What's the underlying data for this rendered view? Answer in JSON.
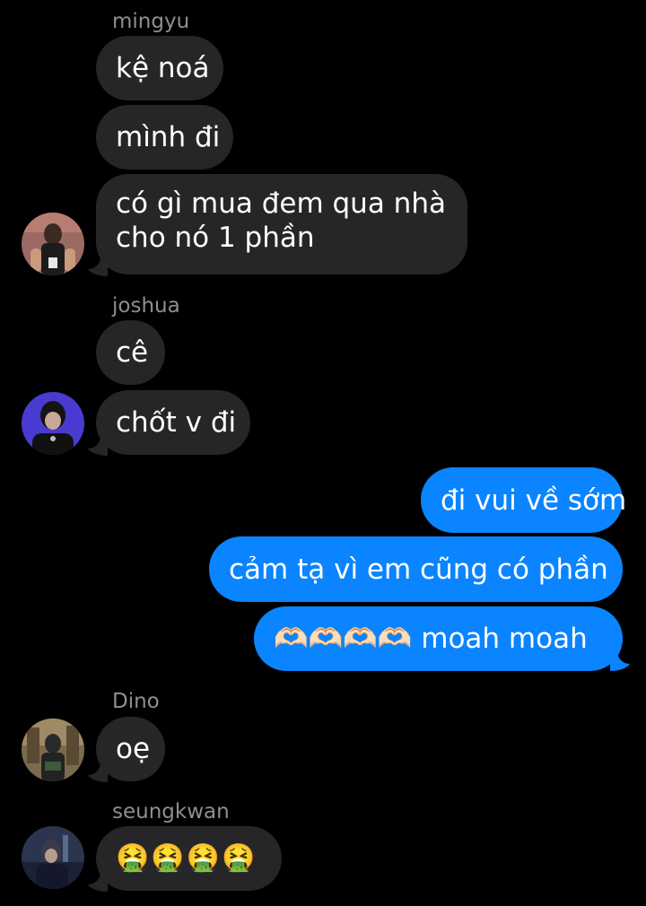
{
  "conversation": {
    "groups": [
      {
        "sender": "mingyu",
        "messages": [
          "kệ noá",
          "mình đi",
          "có gì mua đem qua nhà cho nó 1 phần"
        ],
        "avatar": "profile-photo-mingyu"
      },
      {
        "sender": "joshua",
        "messages": [
          "cê",
          "chốt v đi"
        ],
        "avatar": "profile-photo-joshua"
      },
      {
        "sender": "me",
        "messages": [
          "đi vui về sớm",
          "cảm tạ vì em cũng có phần",
          "🫶🏻🫶🏻🫶🏻🫶🏻 moah moah"
        ]
      },
      {
        "sender": "Dino",
        "messages": [
          "oẹ"
        ],
        "avatar": "profile-photo-dino"
      },
      {
        "sender": "seungkwan",
        "messages": [
          "🤮🤮🤮🤮"
        ],
        "avatar": "profile-photo-seungkwan"
      }
    ]
  },
  "colors": {
    "background": "#000000",
    "incoming_bubble": "#262628",
    "outgoing_bubble": "#0a84ff",
    "sender_name": "#8e8e93"
  }
}
